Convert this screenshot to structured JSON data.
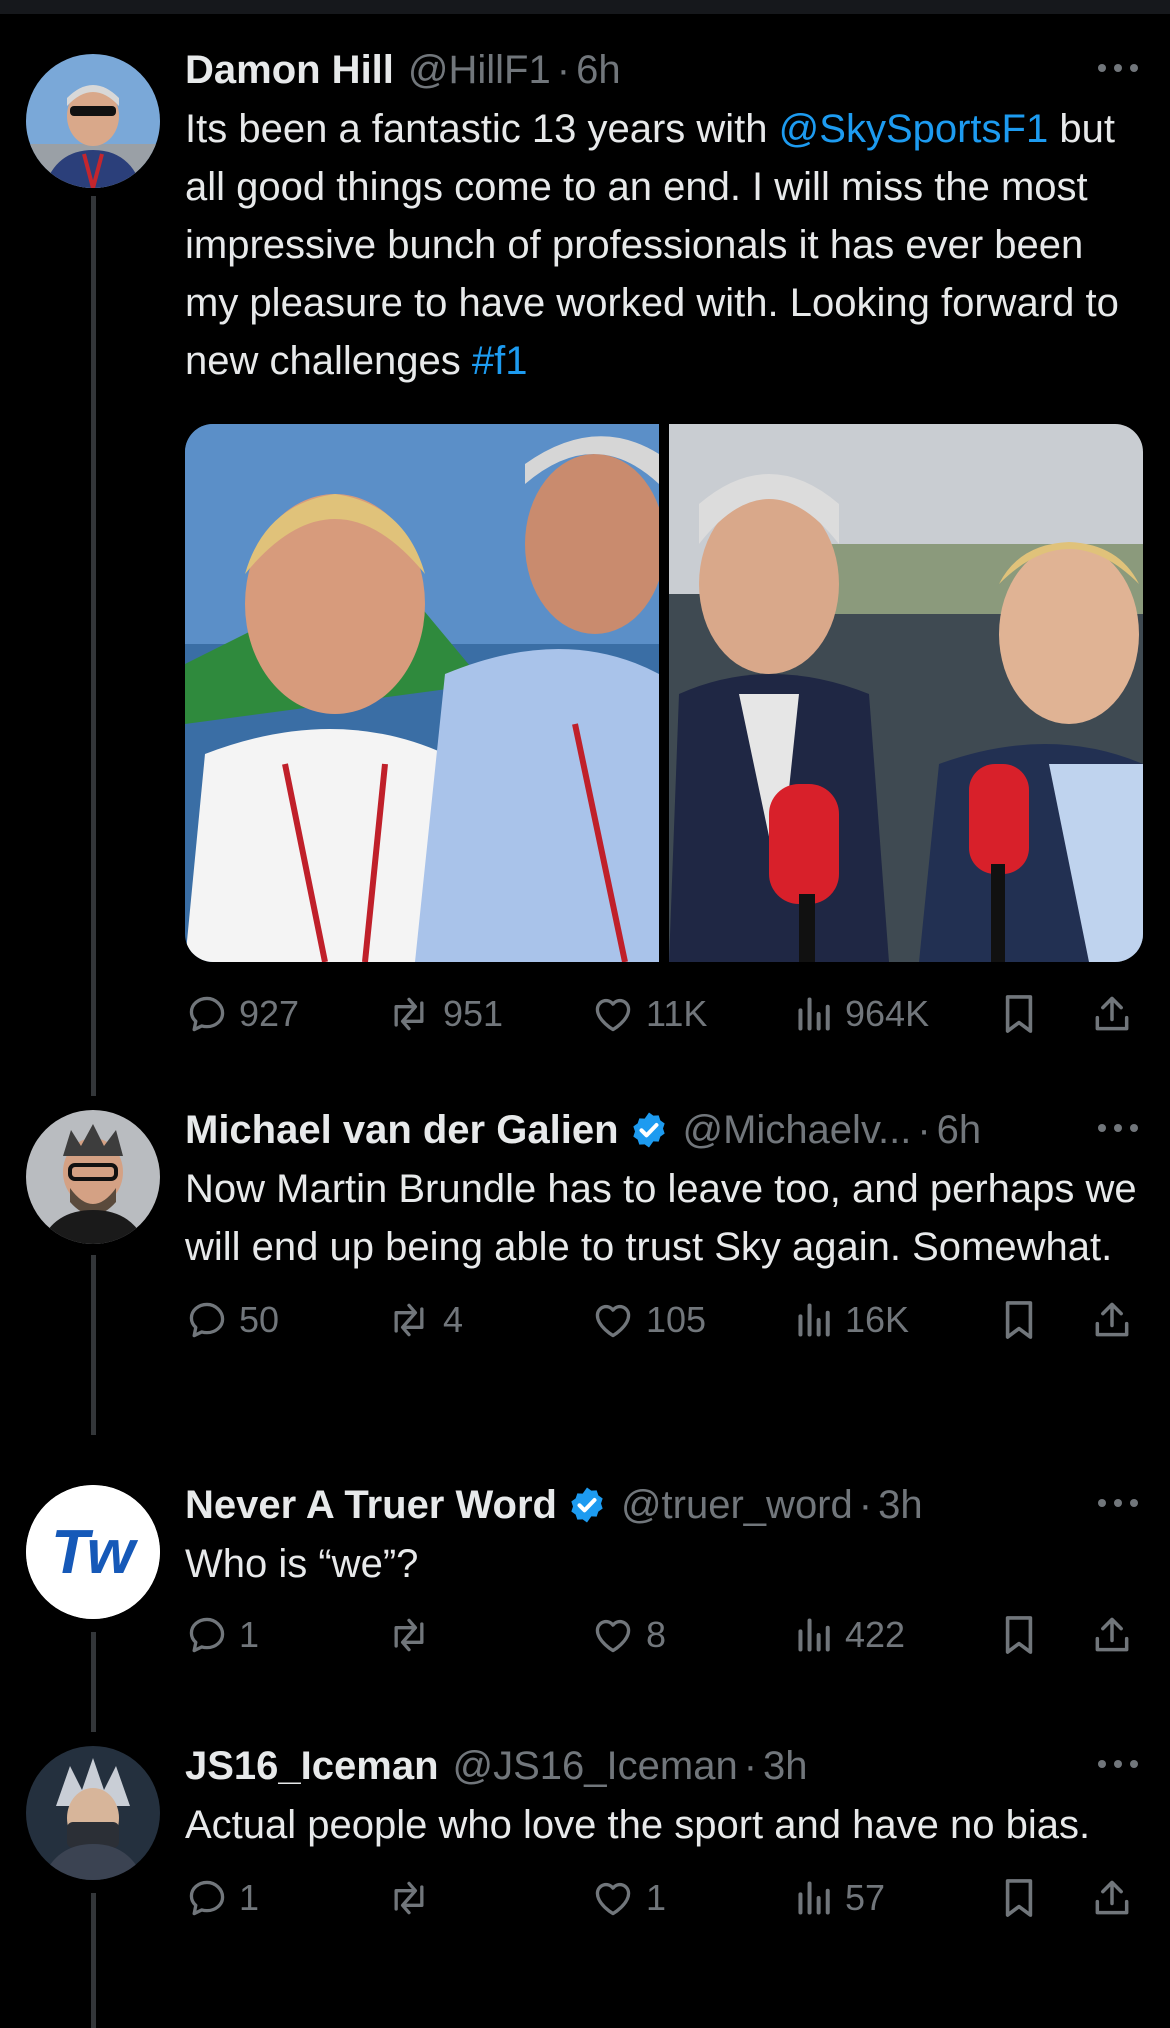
{
  "tweets": [
    {
      "name": "Damon Hill",
      "verified": false,
      "handle": "@HillF1",
      "dot": "·",
      "time": "6h",
      "text_parts": [
        {
          "t": "Its been a fantastic 13 years with ",
          "link": false
        },
        {
          "t": "@SkySportsF1",
          "link": true
        },
        {
          "t": " but all good things come to an end. I will miss the most impressive bunch of professionals it has ever been my pleasure to have worked with. Looking forward to new challenges ",
          "link": false
        },
        {
          "t": "#f1",
          "link": true
        }
      ],
      "counts": {
        "replies": "927",
        "reposts": "951",
        "likes": "11K",
        "views": "964K"
      }
    },
    {
      "name": "Michael van der Galien",
      "verified": true,
      "handle": "@Michaelv...",
      "dot": "·",
      "time": "6h",
      "text_parts": [
        {
          "t": "Now Martin Brundle has to leave too, and perhaps we will end up being able to trust Sky again. Somewhat.",
          "link": false
        }
      ],
      "counts": {
        "replies": "50",
        "reposts": "4",
        "likes": "105",
        "views": "16K"
      }
    },
    {
      "name": "Never A Truer Word",
      "verified": true,
      "handle": "@truer_word",
      "dot": "·",
      "time": "3h",
      "avatar_text": "Tw",
      "text_parts": [
        {
          "t": "Who is “we”?",
          "link": false
        }
      ],
      "counts": {
        "replies": "1",
        "reposts": "",
        "likes": "8",
        "views": "422"
      }
    },
    {
      "name": "JS16_Iceman",
      "verified": false,
      "handle": "@JS16_Iceman",
      "dot": "·",
      "time": "3h",
      "text_parts": [
        {
          "t": "Actual people who love the sport and have no bias.",
          "link": false
        }
      ],
      "counts": {
        "replies": "1",
        "reposts": "",
        "likes": "1",
        "views": "57"
      }
    }
  ],
  "colors": {
    "background": "#000000",
    "text": "#e7e9ea",
    "muted": "#71767b",
    "link": "#1d9bf0",
    "verified": "#1d9bf0",
    "thread_line": "#333639"
  }
}
